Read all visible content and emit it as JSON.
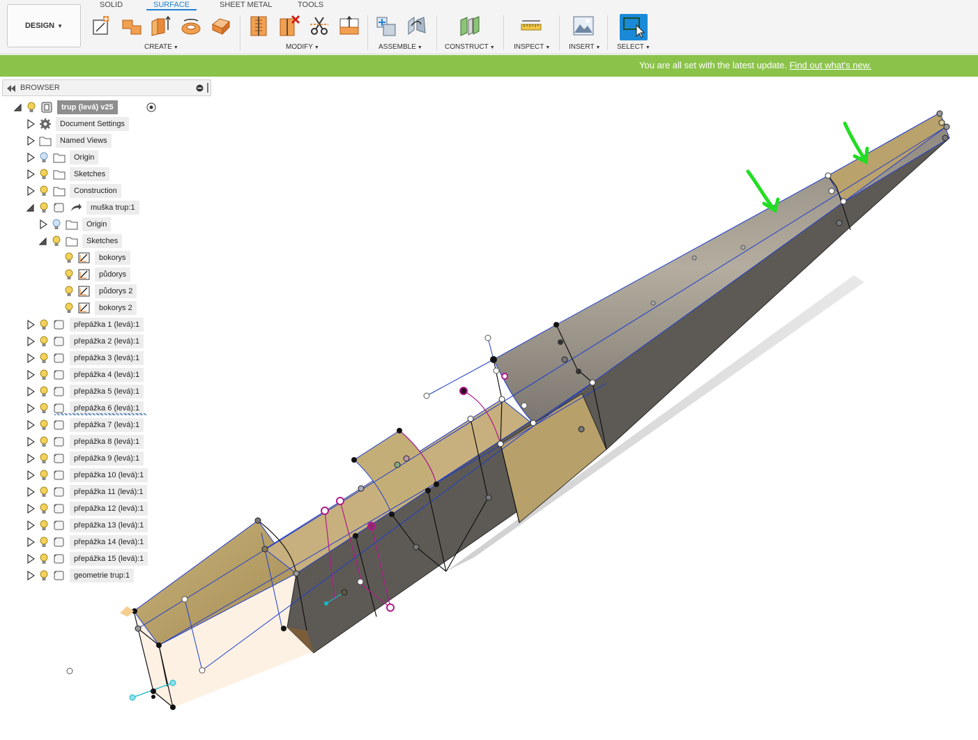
{
  "workspace": {
    "label": "DESIGN"
  },
  "tabs": [
    {
      "label": "SOLID",
      "active": false
    },
    {
      "label": "SURFACE",
      "active": true
    },
    {
      "label": "SHEET METAL",
      "active": false
    },
    {
      "label": "TOOLS",
      "active": false
    }
  ],
  "groups": {
    "create": "CREATE",
    "modify": "MODIFY",
    "assemble": "ASSEMBLE",
    "construct": "CONSTRUCT",
    "inspect": "INSPECT",
    "insert": "INSERT",
    "select": "SELECT"
  },
  "banner": {
    "text": "You are all set with the latest update.",
    "link": "Find out what's new.",
    "color": "#8bc34a"
  },
  "browser": {
    "title": "BROWSER",
    "root": "trup (levá) v25",
    "items": [
      "Document Settings",
      "Named Views",
      "Origin",
      "Sketches",
      "Construction",
      "muška trup:1",
      "Origin",
      "Sketches",
      "bokorys",
      "půdorys",
      "půdorys 2",
      "bokorys 2",
      "přepážka 1 (levá):1",
      "přepážka 2 (levá):1",
      "přepážka 3 (levá):1",
      "přepážka 4 (levá):1",
      "přepážka 5 (levá):1",
      "přepážka 6 (levá):1",
      "přepážka 7 (levá):1",
      "přepážka 8 (levá):1",
      "přepážka 9 (levá):1",
      "přepážka 10 (levá):1",
      "přepážka 11 (levá):1",
      "přepážka 12 (levá):1",
      "přepážka 13 (levá):1",
      "přepážka 14 (levá):1",
      "přepážka 15 (levá):1",
      "geometrie trup:1"
    ]
  },
  "colors": {
    "accent": "#1e7fd1",
    "bulb": "#f2d25a",
    "arrow": "#22dd22"
  }
}
